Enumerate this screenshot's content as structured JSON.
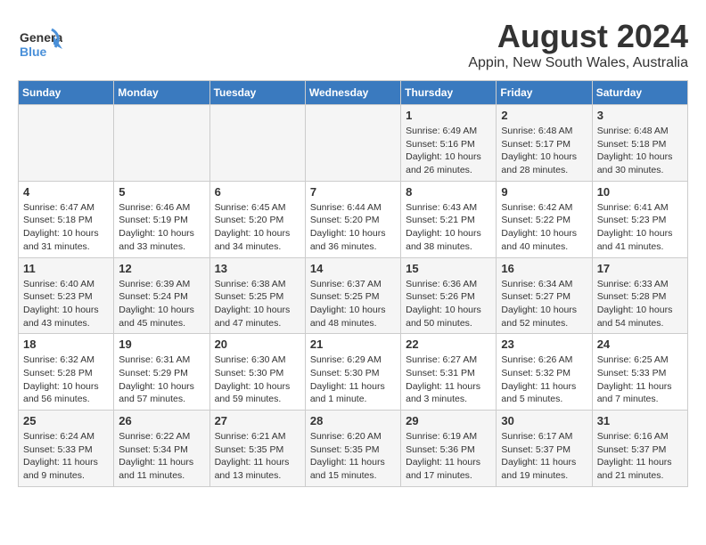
{
  "header": {
    "logo_general": "General",
    "logo_blue": "Blue",
    "month_year": "August 2024",
    "location": "Appin, New South Wales, Australia"
  },
  "days_of_week": [
    "Sunday",
    "Monday",
    "Tuesday",
    "Wednesday",
    "Thursday",
    "Friday",
    "Saturday"
  ],
  "weeks": [
    [
      {
        "day": "",
        "info": ""
      },
      {
        "day": "",
        "info": ""
      },
      {
        "day": "",
        "info": ""
      },
      {
        "day": "",
        "info": ""
      },
      {
        "day": "1",
        "info": "Sunrise: 6:49 AM\nSunset: 5:16 PM\nDaylight: 10 hours\nand 26 minutes."
      },
      {
        "day": "2",
        "info": "Sunrise: 6:48 AM\nSunset: 5:17 PM\nDaylight: 10 hours\nand 28 minutes."
      },
      {
        "day": "3",
        "info": "Sunrise: 6:48 AM\nSunset: 5:18 PM\nDaylight: 10 hours\nand 30 minutes."
      }
    ],
    [
      {
        "day": "4",
        "info": "Sunrise: 6:47 AM\nSunset: 5:18 PM\nDaylight: 10 hours\nand 31 minutes."
      },
      {
        "day": "5",
        "info": "Sunrise: 6:46 AM\nSunset: 5:19 PM\nDaylight: 10 hours\nand 33 minutes."
      },
      {
        "day": "6",
        "info": "Sunrise: 6:45 AM\nSunset: 5:20 PM\nDaylight: 10 hours\nand 34 minutes."
      },
      {
        "day": "7",
        "info": "Sunrise: 6:44 AM\nSunset: 5:20 PM\nDaylight: 10 hours\nand 36 minutes."
      },
      {
        "day": "8",
        "info": "Sunrise: 6:43 AM\nSunset: 5:21 PM\nDaylight: 10 hours\nand 38 minutes."
      },
      {
        "day": "9",
        "info": "Sunrise: 6:42 AM\nSunset: 5:22 PM\nDaylight: 10 hours\nand 40 minutes."
      },
      {
        "day": "10",
        "info": "Sunrise: 6:41 AM\nSunset: 5:23 PM\nDaylight: 10 hours\nand 41 minutes."
      }
    ],
    [
      {
        "day": "11",
        "info": "Sunrise: 6:40 AM\nSunset: 5:23 PM\nDaylight: 10 hours\nand 43 minutes."
      },
      {
        "day": "12",
        "info": "Sunrise: 6:39 AM\nSunset: 5:24 PM\nDaylight: 10 hours\nand 45 minutes."
      },
      {
        "day": "13",
        "info": "Sunrise: 6:38 AM\nSunset: 5:25 PM\nDaylight: 10 hours\nand 47 minutes."
      },
      {
        "day": "14",
        "info": "Sunrise: 6:37 AM\nSunset: 5:25 PM\nDaylight: 10 hours\nand 48 minutes."
      },
      {
        "day": "15",
        "info": "Sunrise: 6:36 AM\nSunset: 5:26 PM\nDaylight: 10 hours\nand 50 minutes."
      },
      {
        "day": "16",
        "info": "Sunrise: 6:34 AM\nSunset: 5:27 PM\nDaylight: 10 hours\nand 52 minutes."
      },
      {
        "day": "17",
        "info": "Sunrise: 6:33 AM\nSunset: 5:28 PM\nDaylight: 10 hours\nand 54 minutes."
      }
    ],
    [
      {
        "day": "18",
        "info": "Sunrise: 6:32 AM\nSunset: 5:28 PM\nDaylight: 10 hours\nand 56 minutes."
      },
      {
        "day": "19",
        "info": "Sunrise: 6:31 AM\nSunset: 5:29 PM\nDaylight: 10 hours\nand 57 minutes."
      },
      {
        "day": "20",
        "info": "Sunrise: 6:30 AM\nSunset: 5:30 PM\nDaylight: 10 hours\nand 59 minutes."
      },
      {
        "day": "21",
        "info": "Sunrise: 6:29 AM\nSunset: 5:30 PM\nDaylight: 11 hours\nand 1 minute."
      },
      {
        "day": "22",
        "info": "Sunrise: 6:27 AM\nSunset: 5:31 PM\nDaylight: 11 hours\nand 3 minutes."
      },
      {
        "day": "23",
        "info": "Sunrise: 6:26 AM\nSunset: 5:32 PM\nDaylight: 11 hours\nand 5 minutes."
      },
      {
        "day": "24",
        "info": "Sunrise: 6:25 AM\nSunset: 5:33 PM\nDaylight: 11 hours\nand 7 minutes."
      }
    ],
    [
      {
        "day": "25",
        "info": "Sunrise: 6:24 AM\nSunset: 5:33 PM\nDaylight: 11 hours\nand 9 minutes."
      },
      {
        "day": "26",
        "info": "Sunrise: 6:22 AM\nSunset: 5:34 PM\nDaylight: 11 hours\nand 11 minutes."
      },
      {
        "day": "27",
        "info": "Sunrise: 6:21 AM\nSunset: 5:35 PM\nDaylight: 11 hours\nand 13 minutes."
      },
      {
        "day": "28",
        "info": "Sunrise: 6:20 AM\nSunset: 5:35 PM\nDaylight: 11 hours\nand 15 minutes."
      },
      {
        "day": "29",
        "info": "Sunrise: 6:19 AM\nSunset: 5:36 PM\nDaylight: 11 hours\nand 17 minutes."
      },
      {
        "day": "30",
        "info": "Sunrise: 6:17 AM\nSunset: 5:37 PM\nDaylight: 11 hours\nand 19 minutes."
      },
      {
        "day": "31",
        "info": "Sunrise: 6:16 AM\nSunset: 5:37 PM\nDaylight: 11 hours\nand 21 minutes."
      }
    ]
  ]
}
